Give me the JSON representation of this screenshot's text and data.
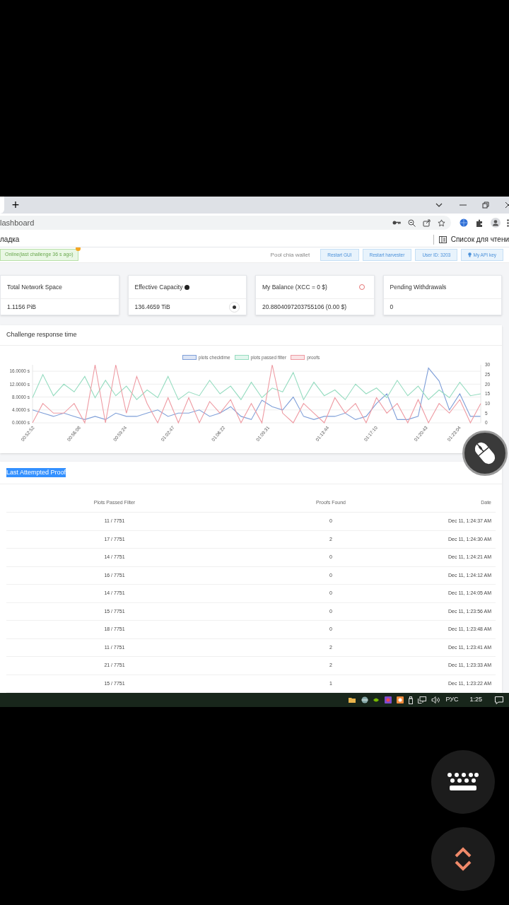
{
  "browser": {
    "new_tab": "+",
    "address": "lashboard",
    "bookmark_left": "ладка",
    "reading_list": "Список для чтени"
  },
  "status": {
    "label": "Online(last challenge 36 s ago)",
    "online": true
  },
  "toolbar": {
    "wallet": "Pool chia wallet",
    "buttons": [
      {
        "label": "Restart GUI",
        "kind": "plain"
      },
      {
        "label": "Restart harvester",
        "kind": "plain"
      },
      {
        "label": "User ID: 3203",
        "kind": "plain"
      },
      {
        "label": "My API key",
        "kind": "bulb"
      }
    ]
  },
  "cards": [
    {
      "title": "Total Network Space",
      "value": "1.1156 PiB",
      "kind": "plain"
    },
    {
      "title": "Effective Capacity",
      "value": "136.4659 TiB",
      "kind": "help"
    },
    {
      "title": "My Balance (XCC = 0 $)",
      "value": "20.8804097203755106 (0.00 $)",
      "kind": "info"
    },
    {
      "title": "Pending Withdrawals",
      "value": "0",
      "kind": "plain"
    }
  ],
  "chart_card": {
    "title": "Challenge response time",
    "charts": [
      {
        "chart_data": {
          "type": "line",
          "grid": true,
          "x": [
            3172,
            3216,
            3261,
            3305,
            3349,
            3394,
            3438,
            3482,
            3526,
            3571,
            3615,
            3659,
            3704,
            3748,
            3792,
            3836,
            3881,
            3925,
            3969,
            4014,
            4058,
            4102,
            4147,
            4191,
            4235,
            4280,
            4324,
            4368,
            4412,
            4457,
            4501,
            4545,
            4590,
            4634,
            4678,
            4722,
            4767,
            4811,
            4855,
            4900,
            4944,
            4988,
            5033,
            5077
          ],
          "xlim": [
            3172,
            5077
          ],
          "xticks": [
            {
              "value": 3172,
              "label": "00:52:52"
            },
            {
              "value": 3368,
              "label": "00:56:08"
            },
            {
              "value": 3564,
              "label": "00:59:24"
            },
            {
              "value": 3767,
              "label": "01:02:47"
            },
            {
              "value": 3982,
              "label": "01:06:22"
            },
            {
              "value": 4171,
              "label": "01:09:31"
            },
            {
              "value": 4424,
              "label": "01:13:44"
            },
            {
              "value": 4630,
              "label": "01:17:10"
            },
            {
              "value": 4843,
              "label": "01:20:43"
            },
            {
              "value": 4984,
              "label": "01:23:04"
            }
          ],
          "ylim": [
            0,
            18
          ],
          "yticks": [
            {
              "value": 16,
              "label": "16.0000 s"
            },
            {
              "value": 12,
              "label": "12.0000 s"
            },
            {
              "value": 8,
              "label": "8.0000 s"
            },
            {
              "value": 4,
              "label": "4.0000 s"
            },
            {
              "value": 0,
              "label": "0.0000 s"
            }
          ],
          "series": [
            {
              "name": "plots checktime",
              "color": "#7f9fd8",
              "values": [
                4,
                3,
                2,
                3,
                2,
                1,
                2,
                1,
                3,
                2,
                2,
                3,
                4,
                2,
                3,
                3,
                4,
                2,
                3,
                5,
                2,
                1,
                7,
                5,
                4,
                8,
                2,
                1,
                2,
                2,
                3,
                1,
                2,
                6,
                9,
                1,
                1,
                2,
                17,
                13,
                4,
                9,
                2,
                2
              ]
            }
          ]
        }
      },
      {
        "chart_data": {
          "type": "line",
          "x": [
            3172,
            3216,
            3261,
            3305,
            3349,
            3394,
            3438,
            3482,
            3526,
            3571,
            3615,
            3659,
            3704,
            3748,
            3792,
            3836,
            3881,
            3925,
            3969,
            4014,
            4058,
            4102,
            4147,
            4191,
            4235,
            4280,
            4324,
            4368,
            4412,
            4457,
            4501,
            4545,
            4590,
            4634,
            4678,
            4722,
            4767,
            4811,
            4855,
            4900,
            4944,
            4988,
            5033,
            5077
          ],
          "xlim": [
            3172,
            5077
          ],
          "ylim": [
            0,
            30
          ],
          "yticks": [
            30,
            25,
            20,
            15,
            10,
            5,
            0
          ],
          "series": [
            {
              "name": "plots passed filter",
              "color": "#96dcc0",
              "values": [
                13,
                25,
                14,
                20,
                16,
                24,
                13,
                22,
                14,
                19,
                12,
                17,
                13,
                24,
                12,
                16,
                14,
                22,
                15,
                19,
                12,
                21,
                13,
                18,
                16,
                26,
                12,
                21,
                14,
                17,
                12,
                20,
                15,
                18,
                13,
                22,
                14,
                19,
                12,
                17,
                13,
                21,
                14,
                15
              ]
            },
            {
              "name": "proofs",
              "color": "#ee9aa2",
              "values": [
                0,
                10,
                5,
                5,
                10,
                0,
                30,
                0,
                30,
                5,
                24,
                10,
                0,
                13,
                0,
                13,
                0,
                11,
                5,
                12,
                0,
                10,
                0,
                30,
                5,
                0,
                10,
                5,
                0,
                13,
                5,
                10,
                0,
                13,
                5,
                10,
                0,
                12,
                0,
                10,
                5,
                12,
                0,
                10
              ]
            }
          ]
        }
      }
    ]
  },
  "table": {
    "title": "Last Attempted Proof",
    "title_selected": true,
    "columns": [
      "Plots Passed Filter",
      "Proofs Found",
      "Date"
    ],
    "rows": [
      [
        "11 / 7751",
        "0",
        "Dec 11, 1:24:37 AM"
      ],
      [
        "17 / 7751",
        "2",
        "Dec 11, 1:24:30 AM"
      ],
      [
        "14 / 7751",
        "0",
        "Dec 11, 1:24:21 AM"
      ],
      [
        "16 / 7751",
        "0",
        "Dec 11, 1:24:12 AM"
      ],
      [
        "14 / 7751",
        "0",
        "Dec 11, 1:24:05 AM"
      ],
      [
        "15 / 7751",
        "0",
        "Dec 11, 1:23:56 AM"
      ],
      [
        "18 / 7751",
        "0",
        "Dec 11, 1:23:48 AM"
      ],
      [
        "11 / 7751",
        "2",
        "Dec 11, 1:23:41 AM"
      ],
      [
        "21 / 7751",
        "2",
        "Dec 11, 1:23:33 AM"
      ],
      [
        "15 / 7751",
        "1",
        "Dec 11, 1:23:22 AM"
      ]
    ]
  },
  "taskbar": {
    "language": "РУС",
    "time": "1:25"
  }
}
